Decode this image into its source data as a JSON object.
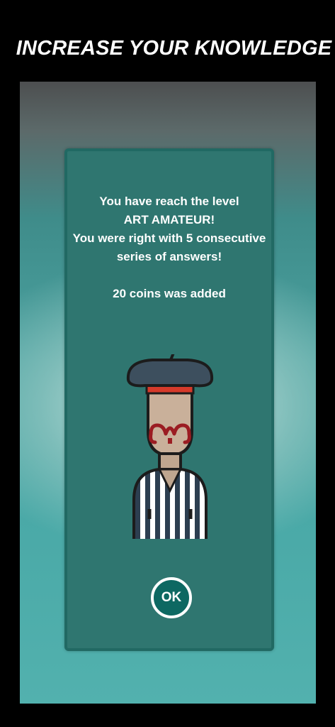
{
  "header": {
    "title": "INCREASE YOUR KNOWLEDGE"
  },
  "dialog": {
    "line1": "You have reach the level",
    "level_name": "ART AMATEUR!",
    "line3": "You were right with 5 consecutive",
    "line4": "series of answers!",
    "coins_message": "20 coins was added",
    "illustration": "french-artist-icon",
    "ok_label": "OK"
  },
  "colors": {
    "background": "#000000",
    "dialog_bg": "#2f7670",
    "dialog_border": "#216963",
    "button_bg": "#0d6862",
    "button_border": "#ffffff",
    "beret_red_band": "#d63a2a",
    "mustache": "#9b1c22"
  }
}
